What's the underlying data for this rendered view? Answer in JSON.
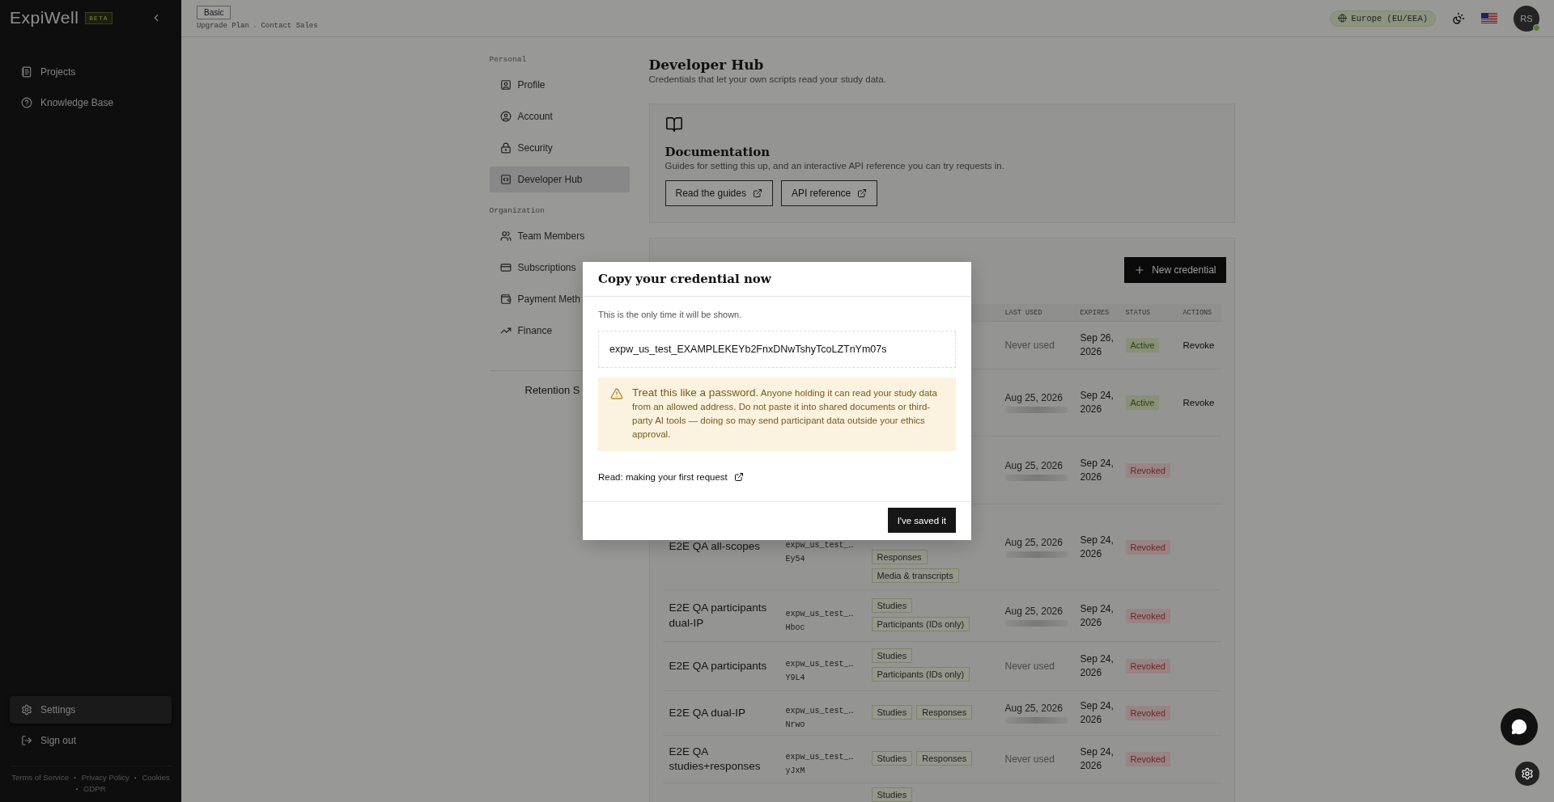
{
  "sidebar": {
    "logo": "ExpiWell",
    "badge": "BETA",
    "nav": [
      {
        "label": "Projects",
        "selected": false
      },
      {
        "label": "Knowledge Base",
        "selected": false
      }
    ],
    "bottom_nav": [
      {
        "label": "Settings",
        "selected": true
      },
      {
        "label": "Sign out",
        "selected": false
      }
    ],
    "footer": [
      {
        "kind": "link",
        "text": "Terms of Service"
      },
      {
        "kind": "separator",
        "text": "·"
      },
      {
        "kind": "link",
        "text": "Privacy Policy"
      },
      {
        "kind": "separator",
        "text": "·"
      },
      {
        "kind": "link",
        "text": "Cookies"
      },
      {
        "kind": "separator",
        "text": "·"
      },
      {
        "kind": "link",
        "text": "GDPR"
      }
    ]
  },
  "header": {
    "plan": "Basic",
    "plan_links": [
      {
        "kind": "link",
        "text": "Upgrade Plan"
      },
      {
        "kind": "separator",
        "text": "·"
      },
      {
        "kind": "link",
        "text": "Contact Sales"
      }
    ],
    "region": "Europe (EU/EEA)",
    "avatar": "RS",
    "avatar_online": true
  },
  "settings_nav": {
    "sections": [
      {
        "title": "Personal",
        "items": [
          {
            "label": "Profile",
            "selected": false
          },
          {
            "label": "Account",
            "selected": false
          },
          {
            "label": "Security",
            "selected": false
          },
          {
            "label": "Developer Hub",
            "selected": true
          }
        ]
      },
      {
        "title": "Organization",
        "items": [
          {
            "label": "Team Members",
            "selected": false
          },
          {
            "label": "Subscriptions",
            "selected": false
          },
          {
            "label": "Payment Meth",
            "selected": false
          },
          {
            "label": "Finance",
            "selected": false
          }
        ]
      }
    ],
    "retention": "Retention S"
  },
  "page": {
    "title": "Developer Hub",
    "subtitle": "Credentials that let your own scripts read your study data."
  },
  "documentation": {
    "title": "Documentation",
    "description": "Guides for setting this up, and an interactive API reference you can try requests in.",
    "buttons": [
      "Read the guides",
      "API reference"
    ]
  },
  "credentials": {
    "new_button": "New credential",
    "columns": [
      "LAST USED",
      "EXPIRES",
      "STATUS",
      "ACTIONS"
    ],
    "rows": [
      {
        "last_used": "Never used",
        "expires": "Sep 26, 2026",
        "status": {
          "kind": "active",
          "label": "Active"
        },
        "action": "Revoke"
      },
      {
        "last_used": "Aug 25, 2026",
        "last_used_redacted": true,
        "expires": "Sep 24, 2026",
        "status": {
          "kind": "active",
          "label": "Active"
        },
        "action": "Revoke"
      },
      {
        "last_used": "Aug 25, 2026",
        "last_used_redacted": true,
        "expires": "Sep 24, 2026",
        "status": {
          "kind": "revoked",
          "label": "Revoked"
        }
      },
      {
        "name": "E2E QA all-scopes",
        "key": "expw_us_test_…",
        "key_suffix": "Ey54",
        "scopes": [
          "Responses",
          "Media & transcripts"
        ],
        "last_used": "Aug 25, 2026",
        "last_used_redacted": true,
        "expires": "Sep 24, 2026",
        "status": {
          "kind": "revoked",
          "label": "Revoked"
        }
      },
      {
        "name": "E2E QA participants dual-IP",
        "key": "expw_us_test_…",
        "key_suffix": "Hboc",
        "scopes": [
          "Studies",
          "Participants (IDs only)"
        ],
        "last_used": "Aug 25, 2026",
        "last_used_redacted": true,
        "expires": "Sep 24, 2026",
        "status": {
          "kind": "revoked",
          "label": "Revoked"
        }
      },
      {
        "name": "E2E QA participants",
        "key": "expw_us_test_…",
        "key_suffix": "Y9L4",
        "scopes": [
          "Studies",
          "Participants (IDs only)"
        ],
        "last_used": "Never used",
        "expires": "Sep 24, 2026",
        "status": {
          "kind": "revoked",
          "label": "Revoked"
        }
      },
      {
        "name": "E2E QA dual-IP",
        "key": "expw_us_test_…",
        "key_suffix": "Nrwo",
        "scopes": [
          "Studies",
          "Responses"
        ],
        "last_used": "Aug 25, 2026",
        "last_used_redacted": true,
        "expires": "Sep 24, 2026",
        "status": {
          "kind": "revoked",
          "label": "Revoked"
        }
      },
      {
        "name": "E2E QA studies+responses",
        "key": "expw_us_test_…",
        "key_suffix": "yJxM",
        "scopes": [
          "Studies",
          "Responses"
        ],
        "last_used": "Never used",
        "expires": "Sep 24, 2026",
        "status": {
          "kind": "revoked",
          "label": "Revoked"
        }
      },
      {
        "scopes": [
          "Studies"
        ]
      }
    ]
  },
  "modal": {
    "title": "Copy your credential now",
    "note": "This is the only time it will be shown.",
    "credential": "expw_us_test_EXAMPLEKEYb2FnxDNwTshyTcoLZTnYm07s",
    "warning": "**Treat this like a password.** Anyone holding it can read your study data from an allowed address. Do not paste it into shared documents or third-party AI tools — doing so may send participant data outside your ethics approval.",
    "link": "Read: making your first request",
    "button": "I've saved it"
  }
}
